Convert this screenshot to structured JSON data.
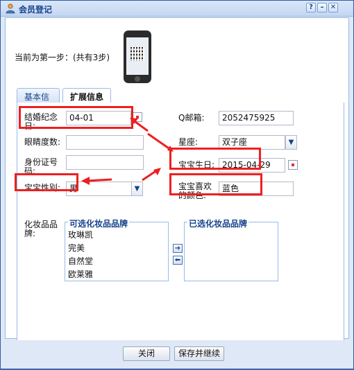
{
  "window": {
    "title": "会员登记"
  },
  "titlebar": {
    "help_label": "?",
    "minimize_label": "–",
    "close_label": "✕"
  },
  "step_text": "当前为第一步：(共有3步)",
  "tabs": [
    {
      "label": "基本信息"
    },
    {
      "label": "扩展信息"
    }
  ],
  "form": {
    "anniversary": {
      "label": "结婚纪念日:",
      "value": "04-01"
    },
    "qq_email": {
      "label": "Q邮箱:",
      "value": "2052475925"
    },
    "eye_degree": {
      "label": "眼睛度数:",
      "value": ""
    },
    "zodiac": {
      "label": "星座:",
      "value": "双子座"
    },
    "id_number": {
      "label": "身份证号码:",
      "value": ""
    },
    "baby_birthday": {
      "label": "宝宝生日:",
      "value": "2015-04-29"
    },
    "baby_gender": {
      "label": "宝宝性别:",
      "value": "男"
    },
    "baby_color": {
      "label": "宝宝喜欢的颜色:",
      "value": "蓝色"
    },
    "cosmetics_label": "化妆品品牌:"
  },
  "available_brands": {
    "title": "可选化妆品品牌",
    "items": [
      "玫琳凯",
      "完美",
      "自然堂",
      "欧莱雅"
    ]
  },
  "selected_brands": {
    "title": "已选化妆品品牌",
    "items": []
  },
  "buttons": {
    "close": "关闭",
    "save_continue": "保存并继续"
  },
  "colors": {
    "highlight": "#ee1f1f",
    "accent": "#15428b",
    "background": "#3f6fb8"
  }
}
